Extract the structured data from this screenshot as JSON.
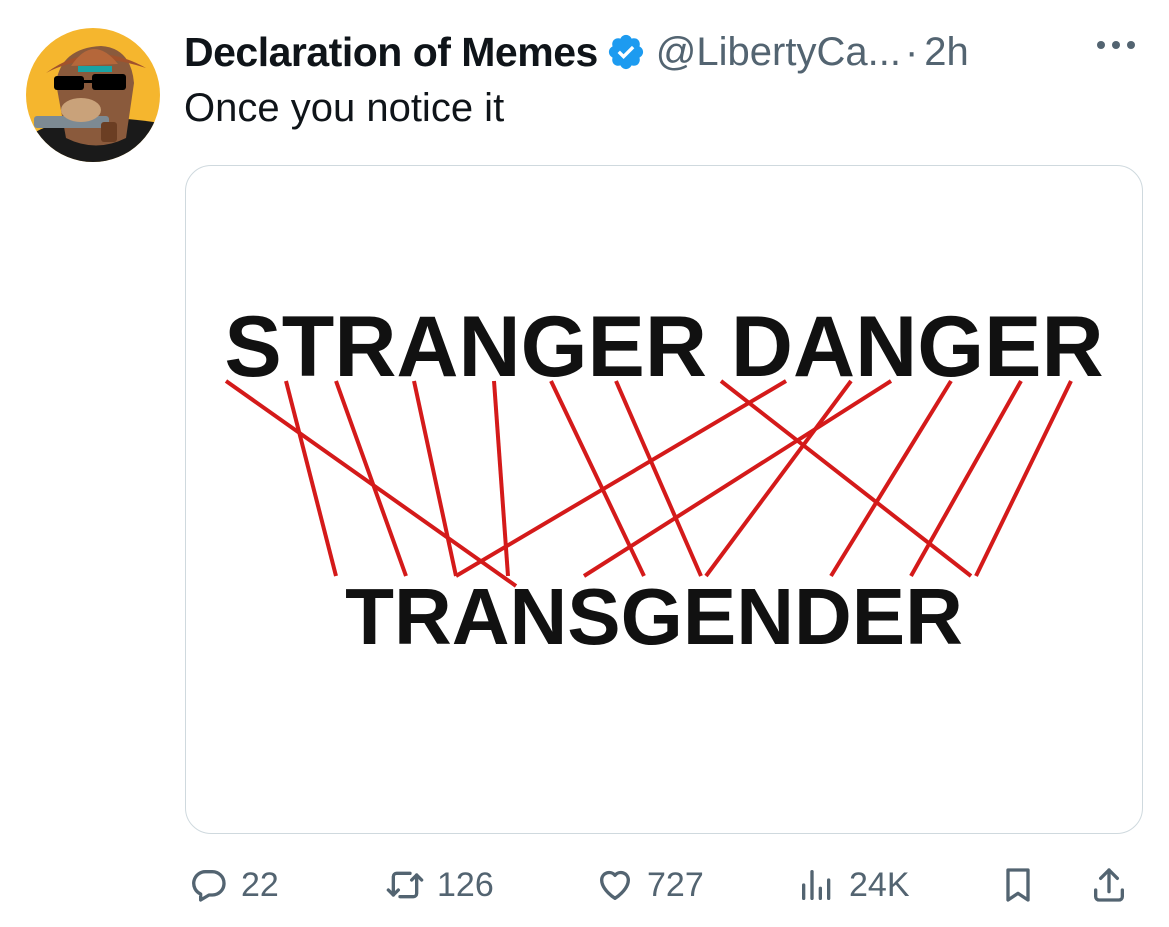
{
  "tweet": {
    "author_name": "Declaration of Memes",
    "handle": "@LibertyCa...",
    "separator": "·",
    "time": "2h",
    "text": "Once you notice it"
  },
  "media": {
    "top_word": "STRANGER DANGER",
    "bottom_word": "TRANSGENDER",
    "line_color": "#d41a1a"
  },
  "actions": {
    "replies": "22",
    "retweets": "126",
    "likes": "727",
    "views": "24K"
  },
  "colors": {
    "verified": "#1d9bf0",
    "secondary_text": "#536471",
    "border": "#cfd9de"
  },
  "icons": [
    "reply-icon",
    "retweet-icon",
    "like-icon",
    "views-icon",
    "bookmark-icon",
    "share-icon",
    "more-icon",
    "verified-badge-icon"
  ]
}
